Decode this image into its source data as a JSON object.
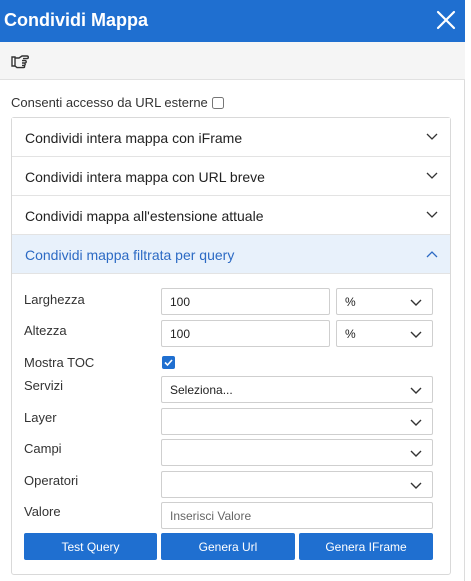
{
  "dialog": {
    "title": "Condividi Mappa"
  },
  "icons": {
    "close": "close-icon",
    "toolbar": "pointing-hand-icon"
  },
  "consent": {
    "label": "Consenti accesso da URL esterne",
    "checked": false
  },
  "accordion": {
    "items": [
      {
        "label": "Condividi intera mappa con iFrame",
        "expanded": false
      },
      {
        "label": "Condividi intera mappa con URL breve",
        "expanded": false
      },
      {
        "label": "Condividi mappa all'estensione attuale",
        "expanded": false
      },
      {
        "label": "Condividi mappa filtrata per query",
        "expanded": true
      }
    ]
  },
  "form": {
    "larghezza": {
      "label": "Larghezza",
      "value": "100",
      "unit": "%"
    },
    "altezza": {
      "label": "Altezza",
      "value": "100",
      "unit": "%"
    },
    "mostra_toc": {
      "label": "Mostra TOC",
      "checked": true
    },
    "servizi": {
      "label": "Servizi",
      "value": "Seleziona..."
    },
    "layer": {
      "label": "Layer",
      "value": ""
    },
    "campi": {
      "label": "Campi",
      "value": ""
    },
    "operatori": {
      "label": "Operatori",
      "value": ""
    },
    "valore": {
      "label": "Valore",
      "placeholder": "Inserisci Valore"
    }
  },
  "buttons": {
    "test_query": "Test Query",
    "genera_url": "Genera Url",
    "genera_iframe": "Genera IFrame"
  },
  "colors": {
    "accent": "#1f6fd0",
    "active_header_bg": "#e8f1fb",
    "active_header_text": "#2c6ac4"
  }
}
